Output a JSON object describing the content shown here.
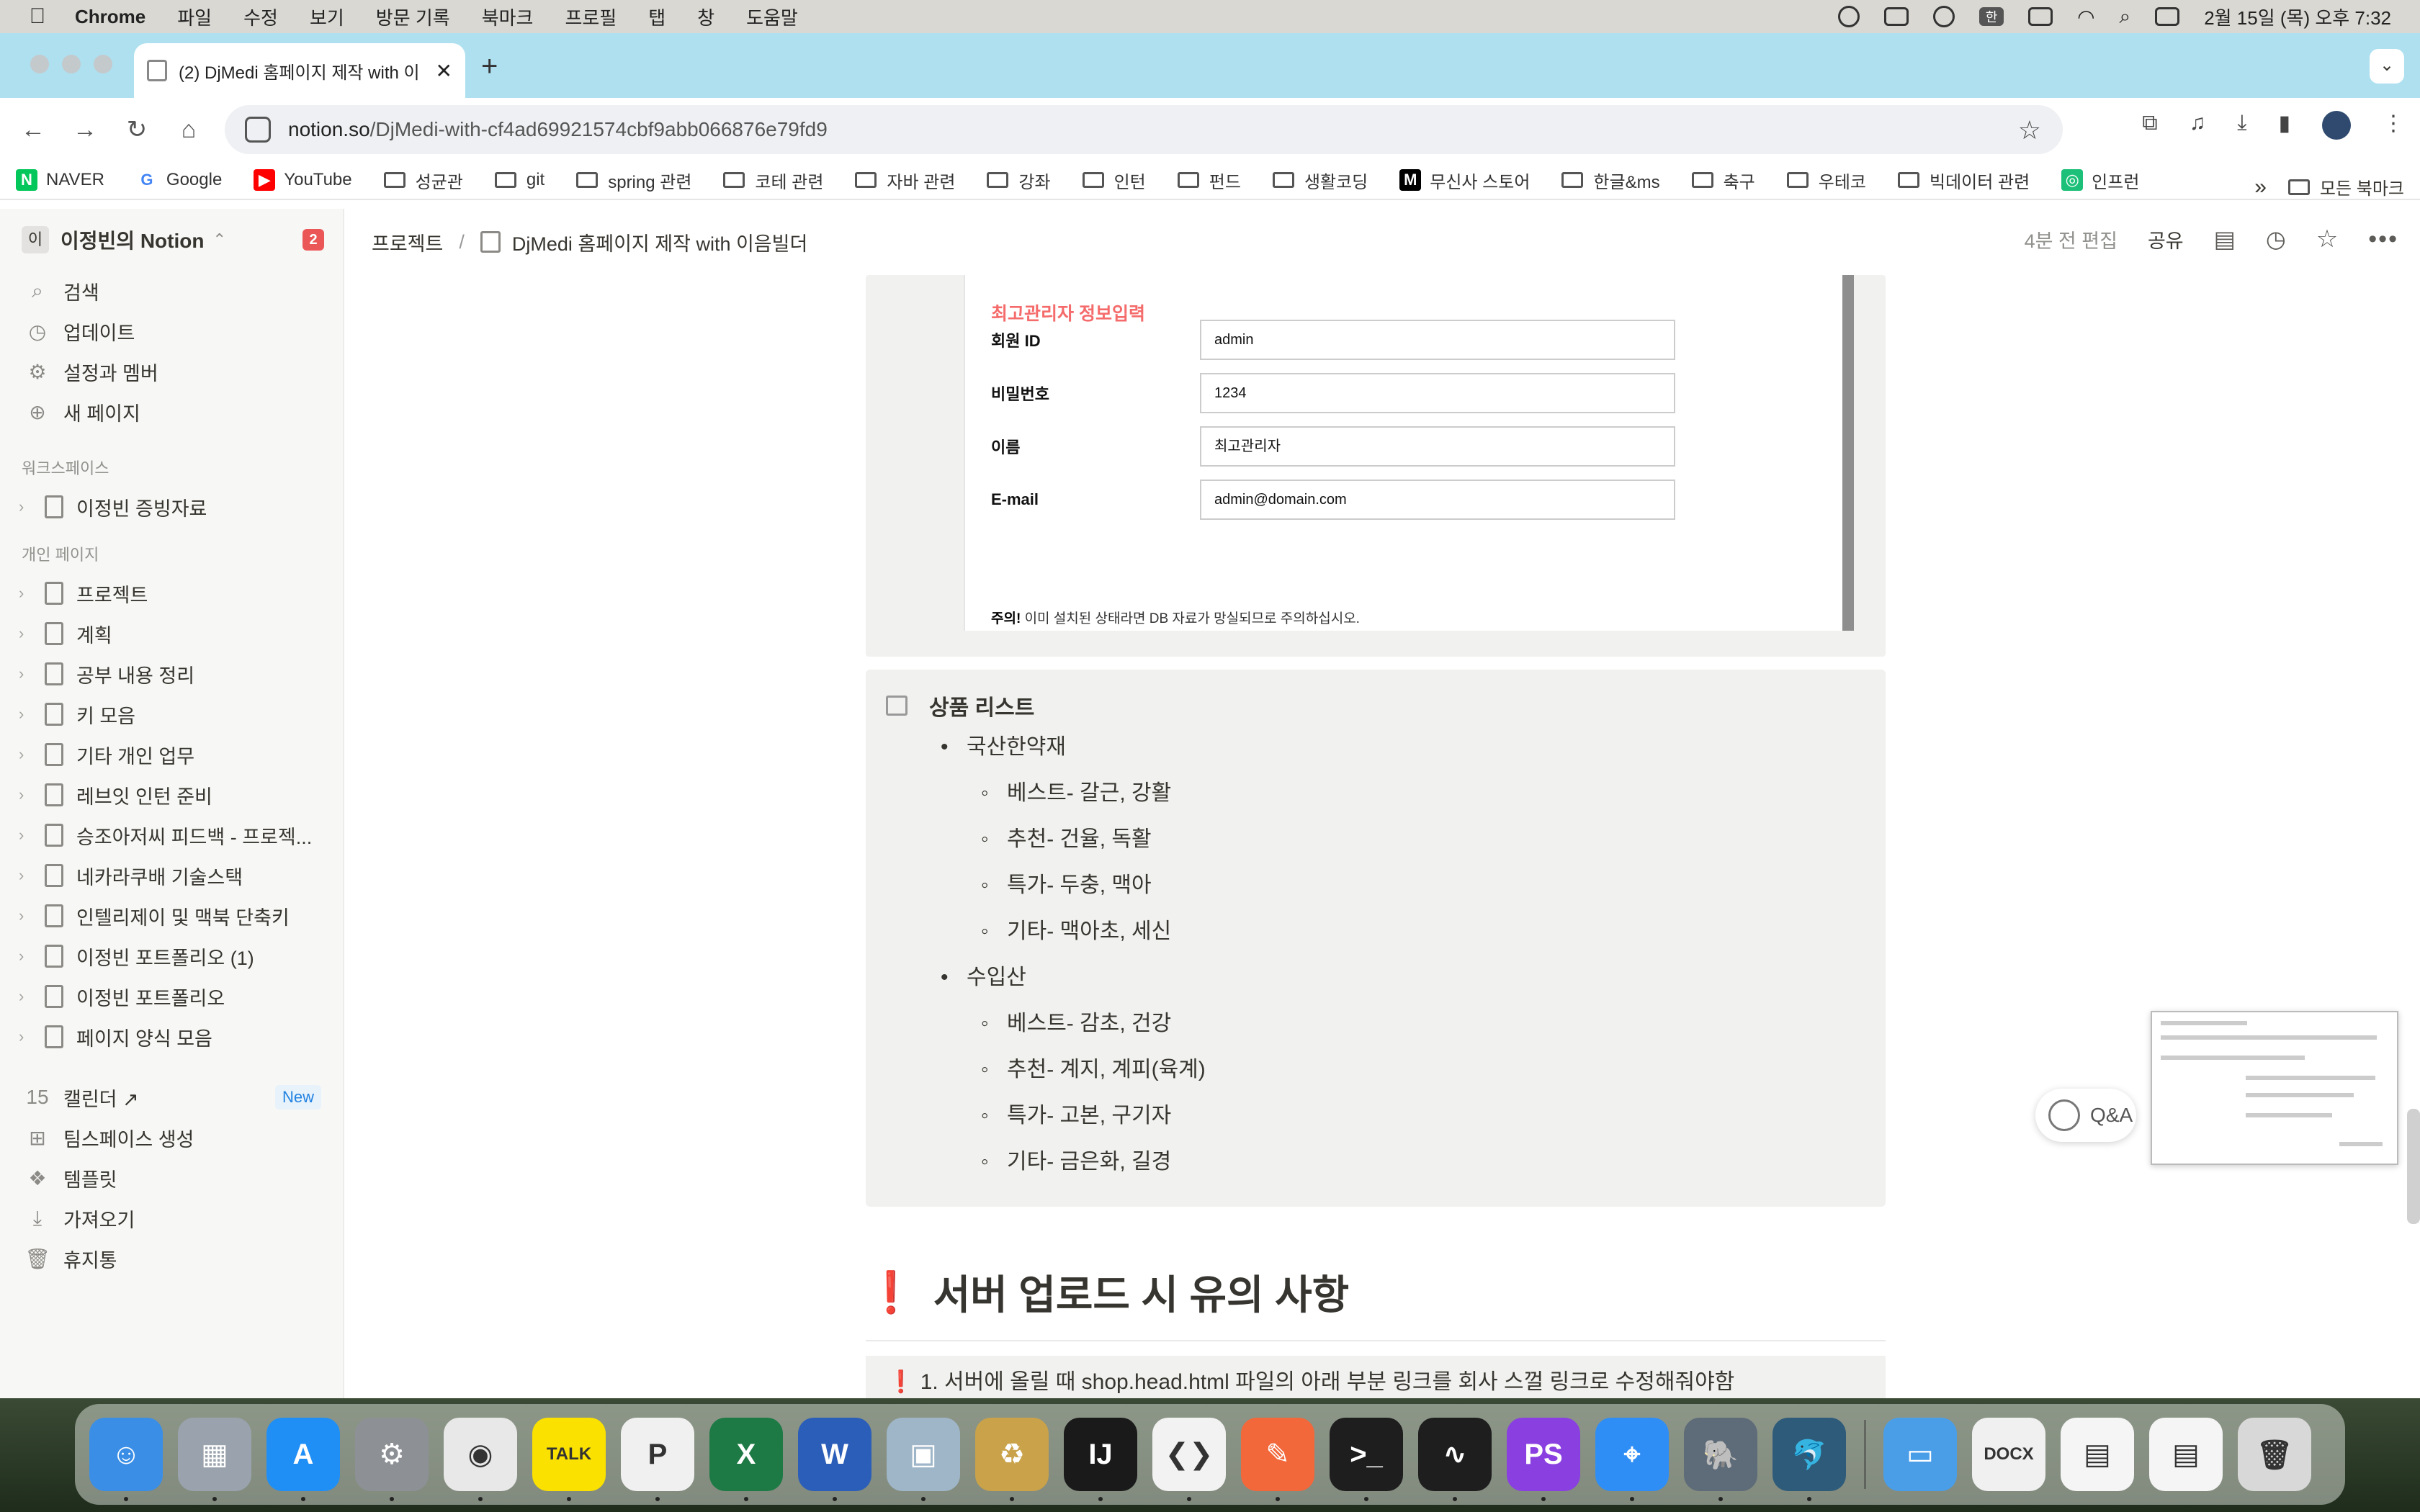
{
  "menubar": {
    "apple": "",
    "items": [
      "Chrome",
      "파일",
      "수정",
      "보기",
      "방문 기록",
      "북마크",
      "프로필",
      "탭",
      "창",
      "도움말"
    ],
    "ime": "한",
    "clock": "2월 15일 (목) 오후 7:32"
  },
  "browser": {
    "tab_title": "(2) DjMedi 홈페이지 제작 with 이",
    "tab_close": "✕",
    "new_tab": "+",
    "tab_menu": "⌄",
    "url_domain": "notion.so",
    "url_path": "/DjMedi-with-cf4ad69921574cbf9abb066876e79fd9",
    "bookmarks": [
      {
        "label": "NAVER",
        "type": "logo",
        "color": "#03c75a",
        "glyph": "N"
      },
      {
        "label": "Google",
        "type": "logo",
        "color": "#ffffff",
        "glyph": "G"
      },
      {
        "label": "YouTube",
        "type": "logo",
        "color": "#ff0000",
        "glyph": "▶"
      },
      {
        "label": "성균관",
        "type": "folder"
      },
      {
        "label": "git",
        "type": "folder"
      },
      {
        "label": "spring 관련",
        "type": "folder"
      },
      {
        "label": "코테 관련",
        "type": "folder"
      },
      {
        "label": "자바 관련",
        "type": "folder"
      },
      {
        "label": "강좌",
        "type": "folder"
      },
      {
        "label": "인턴",
        "type": "folder"
      },
      {
        "label": "펀드",
        "type": "folder"
      },
      {
        "label": "생활코딩",
        "type": "folder"
      },
      {
        "label": "무신사 스토어",
        "type": "logo",
        "color": "#000000",
        "glyph": "M"
      },
      {
        "label": "한글&ms",
        "type": "folder"
      },
      {
        "label": "축구",
        "type": "folder"
      },
      {
        "label": "우테코",
        "type": "folder"
      },
      {
        "label": "빅데이터 관련",
        "type": "folder"
      },
      {
        "label": "인프런",
        "type": "logo",
        "color": "#1dc078",
        "glyph": "◎"
      }
    ],
    "more": "»",
    "all_bookmarks": "모든 북마크"
  },
  "sidebar": {
    "workspace_icon": "이",
    "workspace": "이정빈의 Notion",
    "workspace_chevron": "⌃",
    "notif_count": "2",
    "top_items": [
      {
        "label": "검색",
        "icon": "search-icon",
        "glyph": "⌕"
      },
      {
        "label": "업데이트",
        "icon": "clock-icon",
        "glyph": "◷"
      },
      {
        "label": "설정과 멤버",
        "icon": "gear-icon",
        "glyph": "⚙"
      },
      {
        "label": "새 페이지",
        "icon": "plus-circle-icon",
        "glyph": "⊕"
      }
    ],
    "workspace_section": "워크스페이스",
    "workspace_pages": [
      "이정빈 증빙자료"
    ],
    "private_section": "개인 페이지",
    "private_pages": [
      "프로젝트",
      "계획",
      "공부 내용 정리",
      "키 모음",
      "기타 개인 업무",
      "레브잇 인턴 준비",
      "승조아저씨 피드백 - 프로젝...",
      "네카라쿠배 기술스택",
      "인텔리제이 및 맥북 단축키",
      "이정빈 포트폴리오 (1)",
      "이정빈 포트폴리오",
      "페이지 양식 모음"
    ],
    "bottom_items": [
      {
        "label": "캘린더 ↗",
        "icon": "calendar-icon",
        "glyph": "15"
      },
      {
        "label": "팀스페이스 생성",
        "icon": "teamspace-icon",
        "glyph": "⊞"
      },
      {
        "label": "템플릿",
        "icon": "template-icon",
        "glyph": "❖"
      },
      {
        "label": "가져오기",
        "icon": "import-icon",
        "glyph": "⤓"
      },
      {
        "label": "휴지통",
        "icon": "trash-icon",
        "glyph": "🗑"
      }
    ],
    "new_badge": "New"
  },
  "topbar": {
    "crumb_1": "프로젝트",
    "crumb_sep": "/",
    "crumb_2": "DjMedi 홈페이지 제작 with 이음빌더",
    "edited": "4분 전 편집",
    "share": "공유"
  },
  "screenshot": {
    "heading": "최고관리자 정보입력",
    "fields": [
      {
        "label": "회원 ID",
        "value": "admin"
      },
      {
        "label": "비밀번호",
        "value": "1234"
      },
      {
        "label": "이름",
        "value": "최고관리자"
      },
      {
        "label": "E-mail",
        "value": "admin@domain.com"
      }
    ],
    "warn_bold": "주의!",
    "warn_text": " 이미 설치된 상태라면 DB 자료가 망실되므로 주의하십시오."
  },
  "products": {
    "title": "상품 리스트",
    "groups": [
      {
        "name": "국산한약재",
        "items": [
          "베스트- 갈근, 강활",
          "추천- 건율, 독활",
          "특가- 두충, 맥아",
          "기타- 맥아초, 세신"
        ]
      },
      {
        "name": "수입산",
        "items": [
          "베스트- 감초, 건강",
          "추천- 계지, 계피(육계)",
          "특가- 고본, 구기자",
          "기타- 금은화, 길경"
        ]
      }
    ]
  },
  "section": {
    "bang": "❗",
    "title": "서버 업로드 시 유의 사항",
    "partial": "❗  1. 서버에 올릴 때 shop.head.html 파일의 아래 부분 링크를 회사 스껄 링크로 수정해줘야함"
  },
  "qa": {
    "label": "Q&A"
  },
  "dock": [
    {
      "name": "finder-icon",
      "color": "#3a8ee6",
      "glyph": "☺"
    },
    {
      "name": "launchpad-icon",
      "color": "#9aa3ad",
      "glyph": "▦"
    },
    {
      "name": "app-store-icon",
      "color": "#1f8ff5",
      "glyph": "A"
    },
    {
      "name": "system-settings-icon",
      "color": "#8d9196",
      "glyph": "⚙"
    },
    {
      "name": "chrome-icon",
      "color": "#e8e8e8",
      "glyph": "◉"
    },
    {
      "name": "kakaotalk-icon",
      "color": "#fae100",
      "glyph": "TALK"
    },
    {
      "name": "powerpoint-icon",
      "color": "#f0f0f0",
      "glyph": "P"
    },
    {
      "name": "excel-icon",
      "color": "#1d7a45",
      "glyph": "X"
    },
    {
      "name": "word-icon",
      "color": "#2b5eb8",
      "glyph": "W"
    },
    {
      "name": "preview-icon",
      "color": "#9fb6c8",
      "glyph": "▣"
    },
    {
      "name": "archive-utility-icon",
      "color": "#c9a24a",
      "glyph": "♻"
    },
    {
      "name": "intellij-icon",
      "color": "#1a1a1a",
      "glyph": "IJ"
    },
    {
      "name": "vscode-icon",
      "color": "#f2f2f2",
      "glyph": "❮❯"
    },
    {
      "name": "pen-tool-icon",
      "color": "#f2683b",
      "glyph": "✎"
    },
    {
      "name": "terminal-icon",
      "color": "#1e1e1e",
      "glyph": ">_"
    },
    {
      "name": "activity-monitor-icon",
      "color": "#1e1e1e",
      "glyph": "∿"
    },
    {
      "name": "phpstorm-icon",
      "color": "#8a40e0",
      "glyph": "PS"
    },
    {
      "name": "safari-icon",
      "color": "#2f8ef5",
      "glyph": "⌖"
    },
    {
      "name": "tableplus-elephant-icon",
      "color": "#5e6b78",
      "glyph": "🐘"
    },
    {
      "name": "mysql-workbench-icon",
      "color": "#2e5b7a",
      "glyph": "🐬"
    },
    {
      "name": "downloads-folder-icon",
      "color": "#4a9ee8",
      "glyph": "▭"
    },
    {
      "name": "docx-file-icon",
      "color": "#f0f0f0",
      "glyph": "DOCX"
    },
    {
      "name": "recent-file-icon",
      "color": "#f5f5f5",
      "glyph": "▤"
    },
    {
      "name": "recent-file-2-icon",
      "color": "#f5f5f5",
      "glyph": "▤"
    },
    {
      "name": "trash-icon",
      "color": "#d8d8d8",
      "glyph": "🗑"
    }
  ]
}
